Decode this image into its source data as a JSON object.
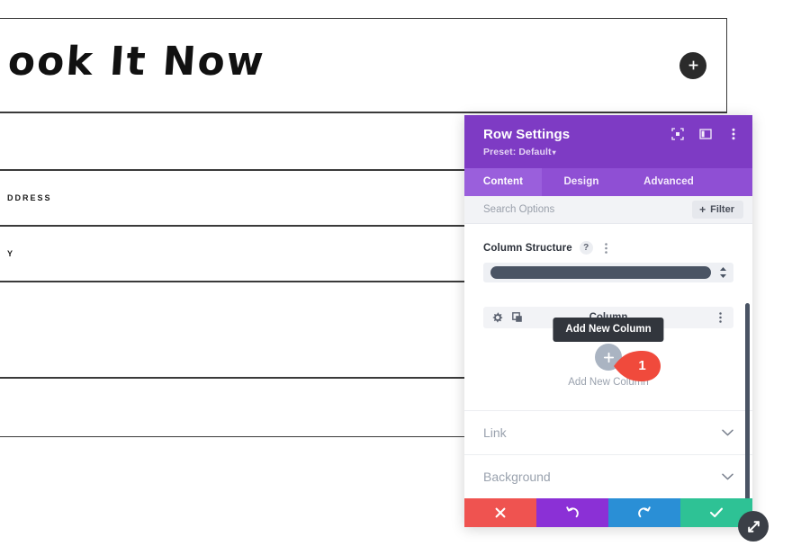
{
  "page": {
    "hero_title": "ook It Now",
    "add_module_icon": "plus-circle-icon",
    "form_labels": [
      "DDRESS",
      "Y"
    ]
  },
  "panel": {
    "title": "Row Settings",
    "preset_label": "Preset: Default",
    "preset_caret": "▾",
    "header_icons": [
      {
        "name": "focus-target-icon"
      },
      {
        "name": "layout-columns-icon"
      },
      {
        "name": "kebab-menu-icon"
      }
    ],
    "tabs": [
      {
        "label": "Content",
        "active": true
      },
      {
        "label": "Design",
        "active": false
      },
      {
        "label": "Advanced",
        "active": false
      }
    ],
    "search": {
      "placeholder": "Search Options",
      "value": ""
    },
    "filter": {
      "label": "Filter",
      "plus": "+"
    },
    "column_structure": {
      "label": "Column Structure",
      "help_glyph": "?",
      "selected_value": ""
    },
    "column_item": {
      "label": "Column",
      "settings_icon": "gear-icon",
      "duplicate_icon": "duplicate-icon",
      "menu_icon": "kebab-menu-icon"
    },
    "add_new_column": {
      "tooltip": "Add New Column",
      "caption": "Add New Column",
      "plus_glyph": "+"
    },
    "marker": {
      "number": "1",
      "color": "#f04a3c"
    },
    "toggle_sections": [
      {
        "label": "Link",
        "chevron": "chevron-down-icon"
      },
      {
        "label": "Background",
        "chevron": "chevron-down-icon"
      }
    ],
    "actions": [
      {
        "name": "cancel",
        "icon": "close-x-icon",
        "color": "#ef5350"
      },
      {
        "name": "undo",
        "icon": "undo-arrow-icon",
        "color": "#8b30d6"
      },
      {
        "name": "redo",
        "icon": "redo-arrow-icon",
        "color": "#2a8fd6"
      },
      {
        "name": "save",
        "icon": "checkmark-icon",
        "color": "#2ec295"
      }
    ],
    "resize_handle_icon": "resize-diagonal-icon",
    "accent_color": "#7e3bc4"
  }
}
